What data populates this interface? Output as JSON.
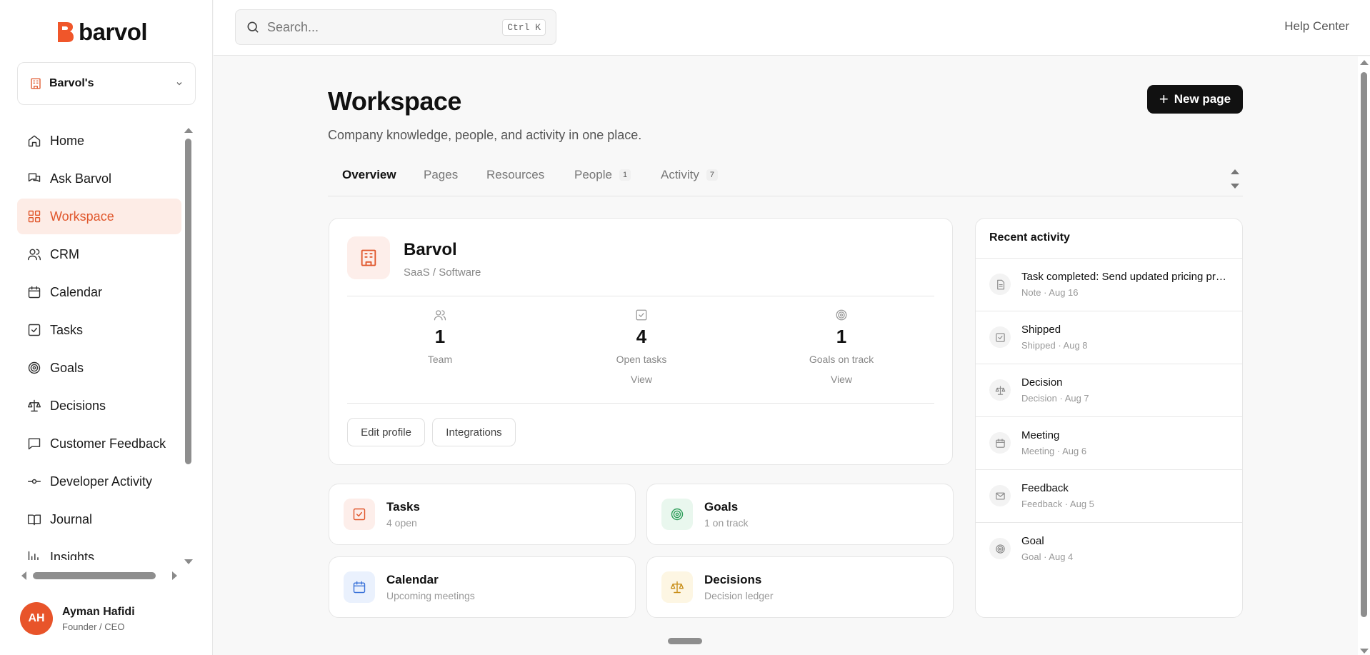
{
  "brand": {
    "name": "barvol",
    "accent": "#e8542a"
  },
  "workspace_select": {
    "label": "Barvol's"
  },
  "sidebar": {
    "items": [
      {
        "label": "Home",
        "icon": "home-icon"
      },
      {
        "label": "Ask Barvol",
        "icon": "chat-icon"
      },
      {
        "label": "Workspace",
        "icon": "grid-icon",
        "active": true
      },
      {
        "label": "CRM",
        "icon": "users-icon"
      },
      {
        "label": "Calendar",
        "icon": "calendar-icon"
      },
      {
        "label": "Tasks",
        "icon": "check-square-icon"
      },
      {
        "label": "Goals",
        "icon": "target-icon"
      },
      {
        "label": "Decisions",
        "icon": "scale-icon"
      },
      {
        "label": "Customer Feedback",
        "icon": "message-square-icon"
      },
      {
        "label": "Developer Activity",
        "icon": "commit-icon"
      },
      {
        "label": "Journal",
        "icon": "book-icon"
      },
      {
        "label": "Insights",
        "icon": "bar-chart-icon"
      }
    ]
  },
  "user": {
    "initials": "AH",
    "name": "Ayman Hafidi",
    "role": "Founder / CEO"
  },
  "topbar": {
    "search_placeholder": "Search...",
    "shortcut": "Ctrl K",
    "help": "Help Center"
  },
  "page": {
    "title": "Workspace",
    "subtitle": "Company knowledge, people, and activity in one place.",
    "new_page": "New page"
  },
  "tabs": [
    {
      "label": "Overview",
      "active": true,
      "badge": ""
    },
    {
      "label": "Pages",
      "badge": ""
    },
    {
      "label": "Resources",
      "badge": ""
    },
    {
      "label": "People",
      "badge": "1"
    },
    {
      "label": "Activity",
      "badge": "7"
    }
  ],
  "profile": {
    "name": "Barvol",
    "type": "SaaS / Software",
    "stats": [
      {
        "value": "1",
        "label": "Team",
        "link": "",
        "icon": "users-icon"
      },
      {
        "value": "4",
        "label": "Open tasks",
        "link": "View",
        "icon": "check-square-icon"
      },
      {
        "value": "1",
        "label": "Goals on track",
        "link": "View",
        "icon": "target-icon"
      }
    ],
    "edit_profile": "Edit profile",
    "integrations": "Integrations"
  },
  "tiles": [
    {
      "name": "Tasks",
      "sub": "4 open",
      "icon": "check-square-icon",
      "bg": "#fdeeea",
      "color": "#e0572c"
    },
    {
      "name": "Goals",
      "sub": "1 on track",
      "icon": "target-icon",
      "bg": "#e9f7ee",
      "color": "#2f9e5b"
    },
    {
      "name": "Calendar",
      "sub": "Upcoming meetings",
      "icon": "calendar-icon",
      "bg": "#eaf1fd",
      "color": "#3b73d9"
    },
    {
      "name": "Decisions",
      "sub": "Decision ledger",
      "icon": "scale-icon",
      "bg": "#fdf6e3",
      "color": "#c9901c"
    }
  ],
  "recent": {
    "title": "Recent activity",
    "items": [
      {
        "title": "Task completed: Send updated pricing proposal",
        "meta": "Note · Aug 16",
        "icon": "document-icon"
      },
      {
        "title": "Shipped",
        "meta": "Shipped · Aug 8",
        "icon": "check-square-icon"
      },
      {
        "title": "Decision",
        "meta": "Decision · Aug 7",
        "icon": "scale-icon"
      },
      {
        "title": "Meeting",
        "meta": "Meeting · Aug 6",
        "icon": "calendar-icon"
      },
      {
        "title": "Feedback",
        "meta": "Feedback · Aug 5",
        "icon": "mail-icon"
      },
      {
        "title": "Goal",
        "meta": "Goal · Aug 4",
        "icon": "target-icon"
      }
    ]
  }
}
